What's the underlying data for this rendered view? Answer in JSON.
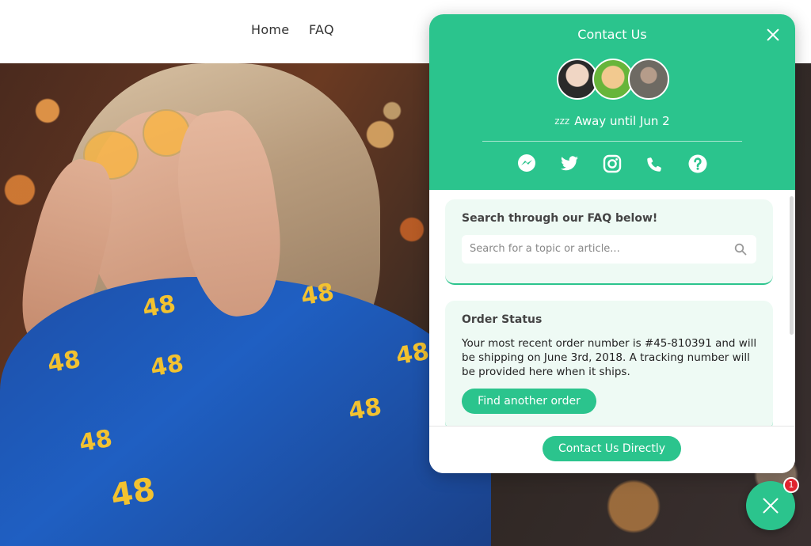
{
  "nav": {
    "links": [
      {
        "label": "Home"
      },
      {
        "label": "FAQ"
      }
    ]
  },
  "hero": {
    "shirt_numbers": [
      "48",
      "48",
      "48",
      "48",
      "48",
      "48",
      "48",
      "48"
    ]
  },
  "widget": {
    "title": "Contact Us",
    "status": "Away until Jun 2",
    "status_icon": "zzz",
    "social_icons": [
      "messenger-icon",
      "twitter-icon",
      "instagram-icon",
      "phone-icon",
      "help-icon"
    ],
    "faq_card": {
      "title": "Search through our FAQ below!",
      "search_placeholder": "Search for a topic or article..."
    },
    "order_card": {
      "title": "Order Status",
      "body": "Your most recent order number is #45-810391 and will be shipping on June 3rd, 2018. A tracking number will be provided here when it ships.",
      "button_label": "Find another order"
    },
    "footer_button_label": "Contact Us Directly"
  },
  "launcher": {
    "badge_count": "1"
  },
  "colors": {
    "accent": "#2bc48d",
    "badge": "#e0242f"
  }
}
